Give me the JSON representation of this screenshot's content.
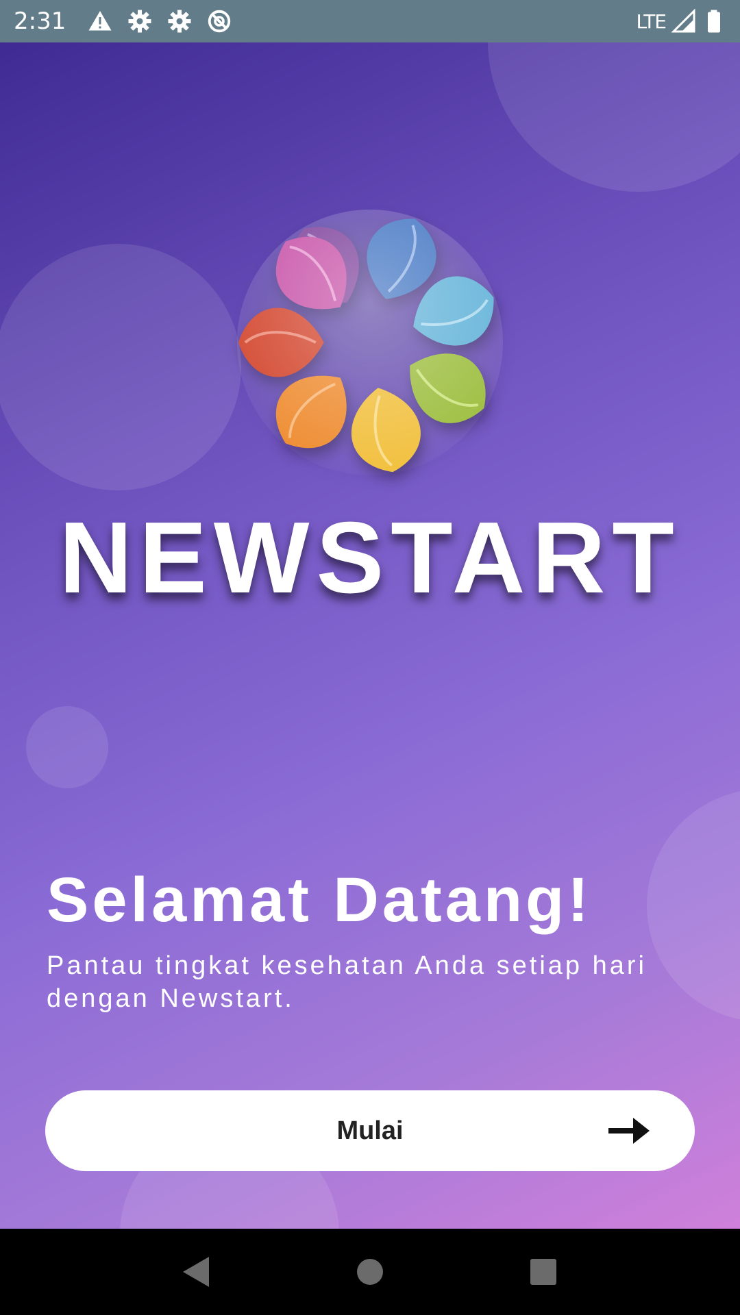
{
  "status_bar": {
    "time": "2:31",
    "network": "LTE",
    "icons": [
      "warning-icon",
      "gear-icon",
      "gear-icon",
      "no-disturb-icon",
      "signal-icon",
      "battery-icon"
    ]
  },
  "app": {
    "brand_title": "NEWSTART",
    "welcome_heading": "Selamat Datang!",
    "welcome_text": "Pantau tingkat kesehatan Anda setiap hari dengan Newstart.",
    "start_button": {
      "label": "Mulai",
      "icon": "arrow-right-icon"
    }
  },
  "nav_bar": {
    "buttons": [
      "back-icon",
      "home-icon",
      "recents-icon"
    ]
  },
  "colors": {
    "status_bar": "#627d89",
    "gradient_start": "#3f2a93",
    "gradient_end": "#cf80da",
    "button_bg": "#ffffff"
  }
}
